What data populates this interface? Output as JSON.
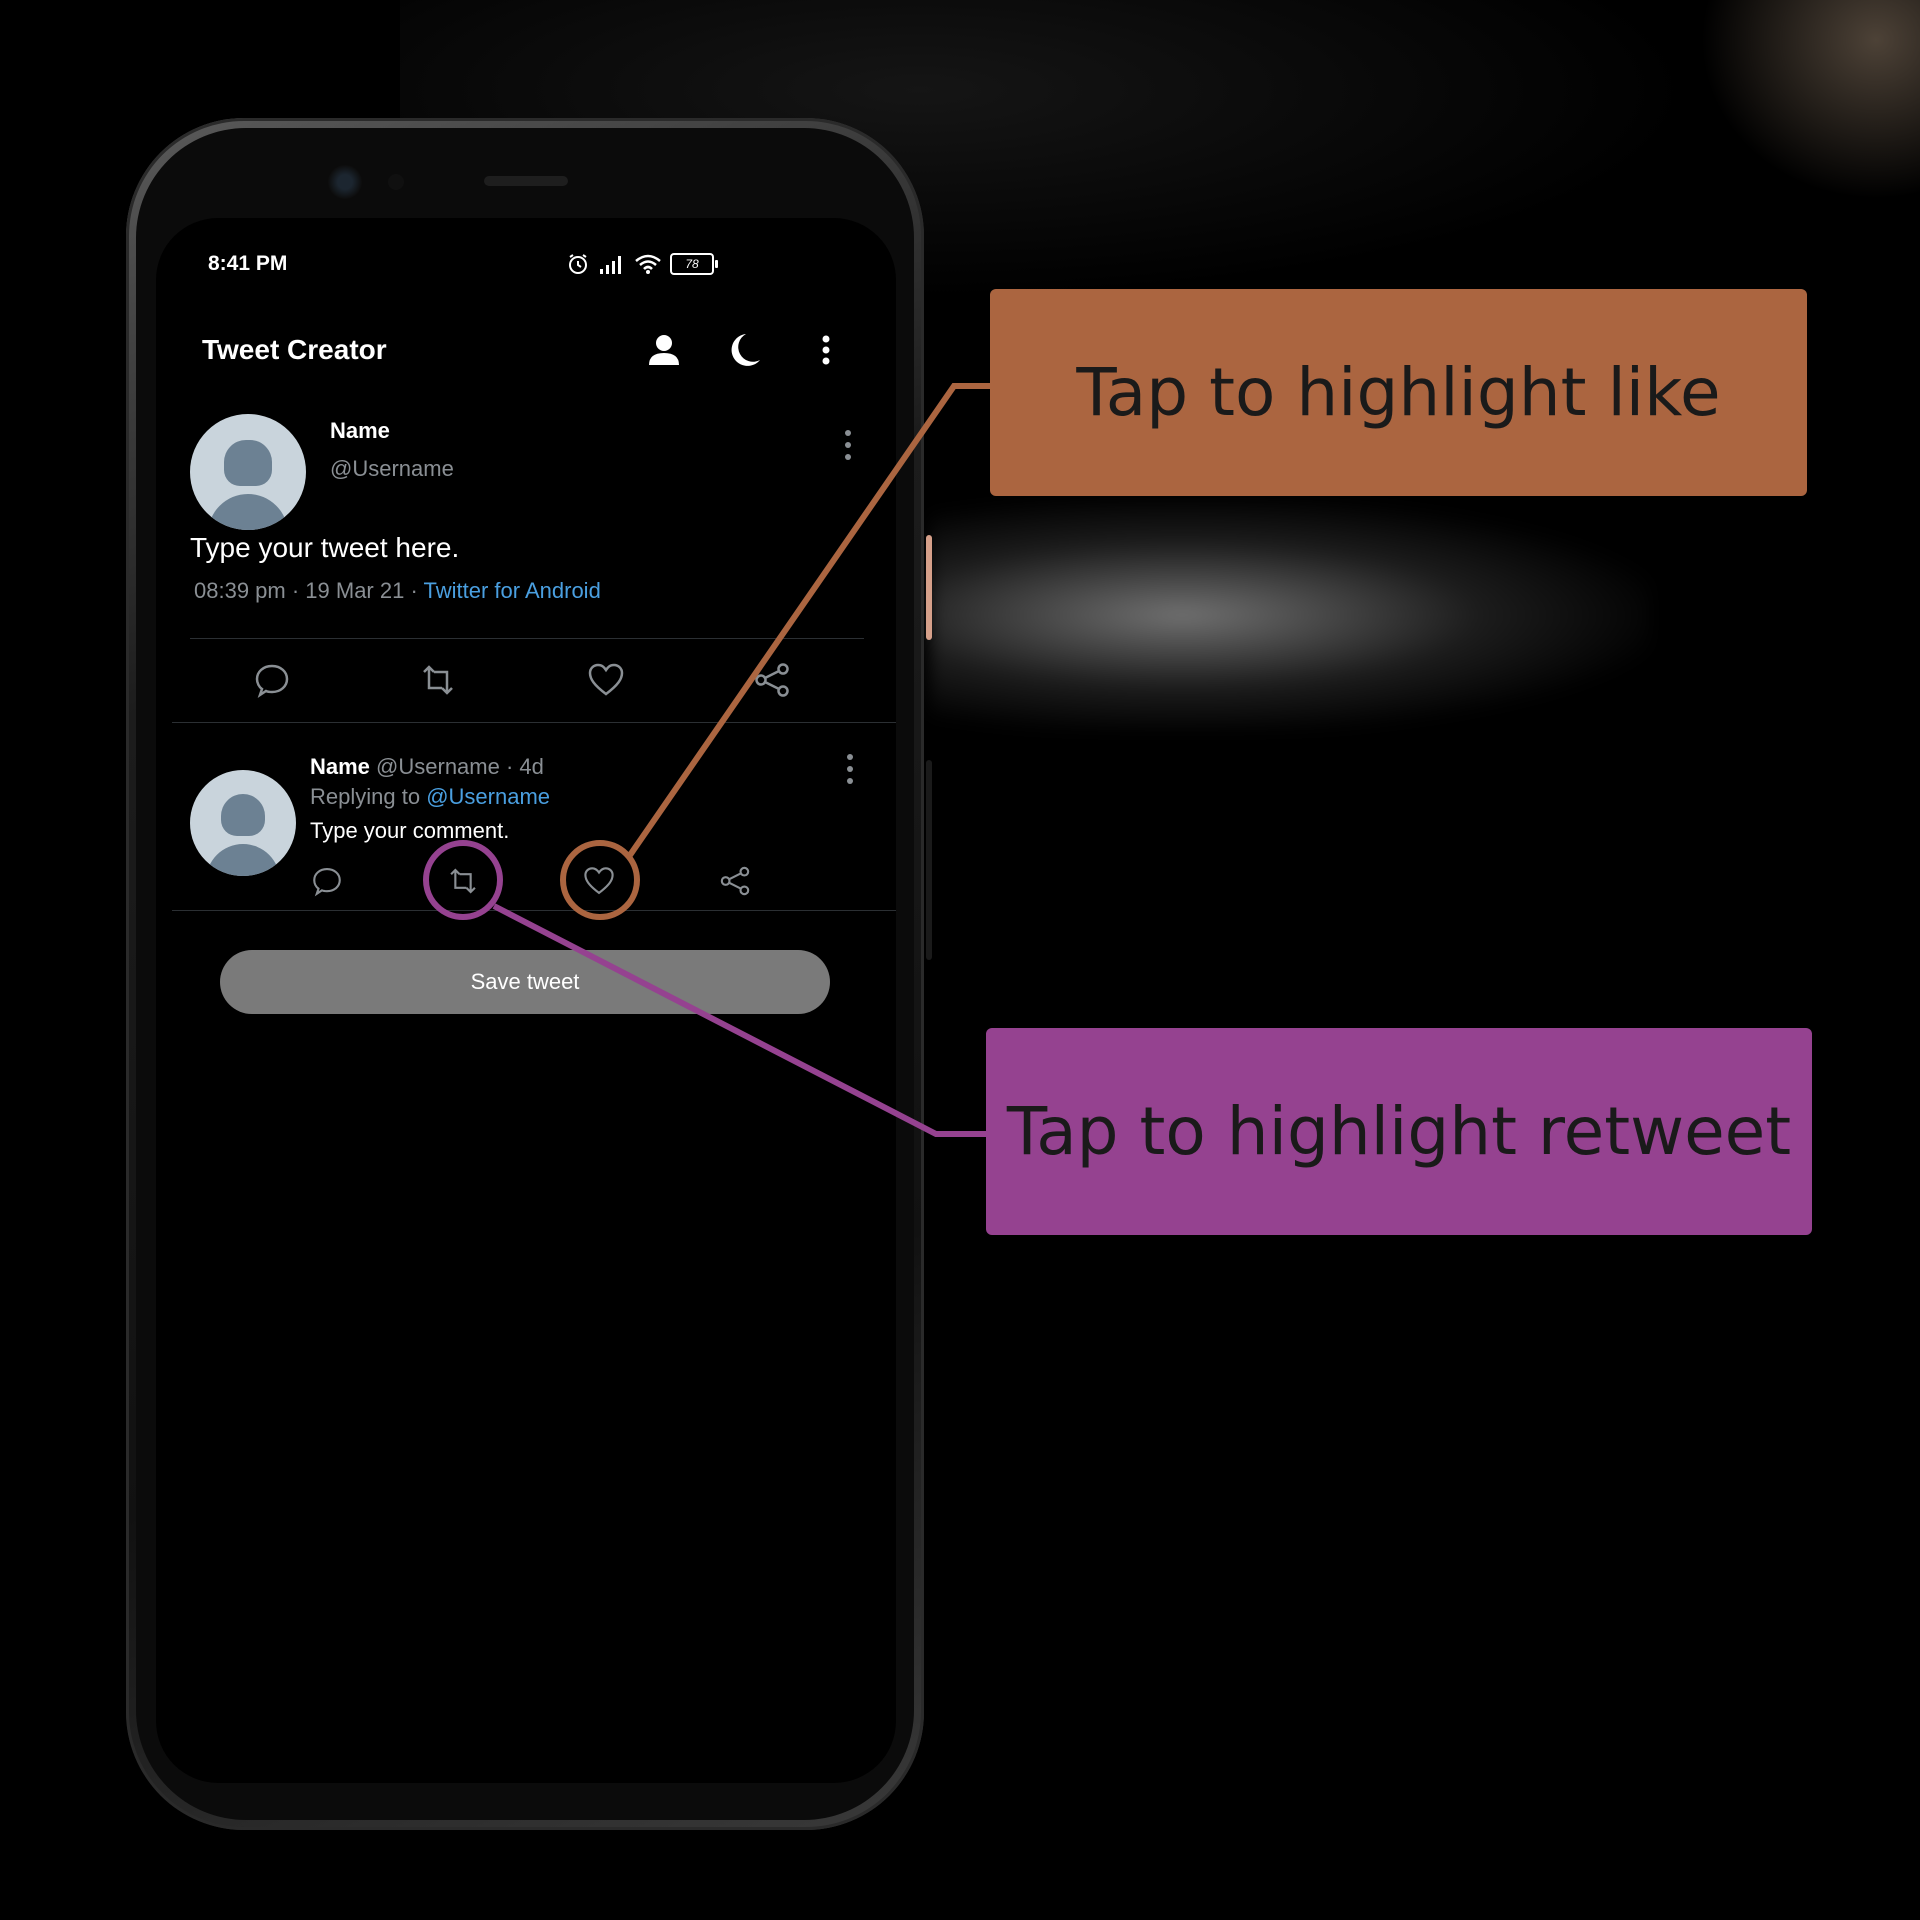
{
  "status_bar": {
    "time": "8:41 PM",
    "battery": "78",
    "icons": [
      "alarm-icon",
      "signal-icon",
      "wifi-icon",
      "battery-icon"
    ]
  },
  "app_bar": {
    "title": "Tweet Creator",
    "actions": [
      "profile-icon",
      "night-mode-icon",
      "more-vert-icon"
    ]
  },
  "main_tweet": {
    "name": "Name",
    "username": "@Username",
    "text": "Type your tweet here.",
    "timestamp": "08:39 pm · 19 Mar 21 · ",
    "source": "Twitter for Android",
    "actions": [
      "reply-icon",
      "retweet-icon",
      "like-icon",
      "share-icon"
    ]
  },
  "reply": {
    "name": "Name",
    "meta": " @Username · 4d",
    "replying_prefix": "Replying to ",
    "replying_user": "@Username",
    "text": "Type your comment.",
    "actions": [
      "reply-icon",
      "retweet-icon",
      "like-icon",
      "share-icon"
    ]
  },
  "save_button": {
    "label": "Save tweet"
  },
  "callouts": {
    "like": "Tap to highlight like",
    "retweet": "Tap to highlight retweet"
  },
  "colors": {
    "like_accent": "#ab6540",
    "retweet_accent": "#954290",
    "link": "#4a9fe0",
    "muted_text": "#8a8f94"
  }
}
